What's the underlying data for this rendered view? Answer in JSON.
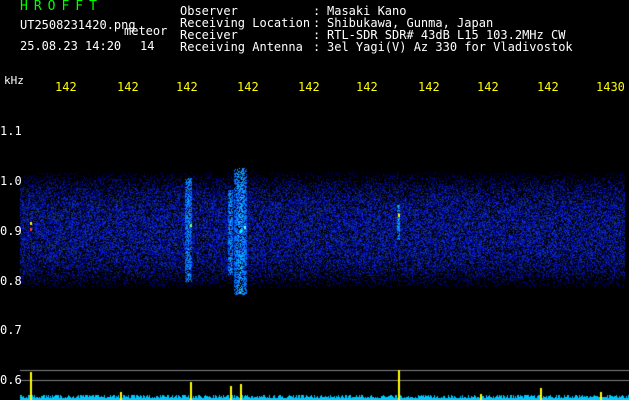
{
  "header": {
    "brand": "HROFFT",
    "filename": "UT2508231420.png",
    "mode": "meteor",
    "datetime": "25.08.23 14:20",
    "hour_short": "14",
    "fields": [
      {
        "label": "Observer",
        "value": "Masaki Kano"
      },
      {
        "label": "Receiving Location",
        "value": "Shibukawa, Gunma, Japan"
      },
      {
        "label": "Receiver",
        "value": "RTL-SDR SDR# 43dB L15 103.2MHz CW"
      },
      {
        "label": "Receiving Antenna",
        "value": "3el Yagi(V) Az 330 for Vladivostok"
      }
    ],
    "separator": ":"
  },
  "axis": {
    "unit": "kHz",
    "freq_labels": [
      "142",
      "142",
      "142",
      "142",
      "142",
      "142",
      "142",
      "142",
      "142",
      "1430"
    ],
    "y_labels": [
      "1.1",
      "1.0",
      "0.9",
      "0.8",
      "0.7",
      "0.6"
    ]
  },
  "colors": {
    "background": "#000000",
    "brand": "#00ff00",
    "text": "#ffffff",
    "freq_label": "#ffff00",
    "noise_band": "#1a3cff",
    "power_trace": "#00c8ff",
    "peak": "#ffff00"
  }
}
